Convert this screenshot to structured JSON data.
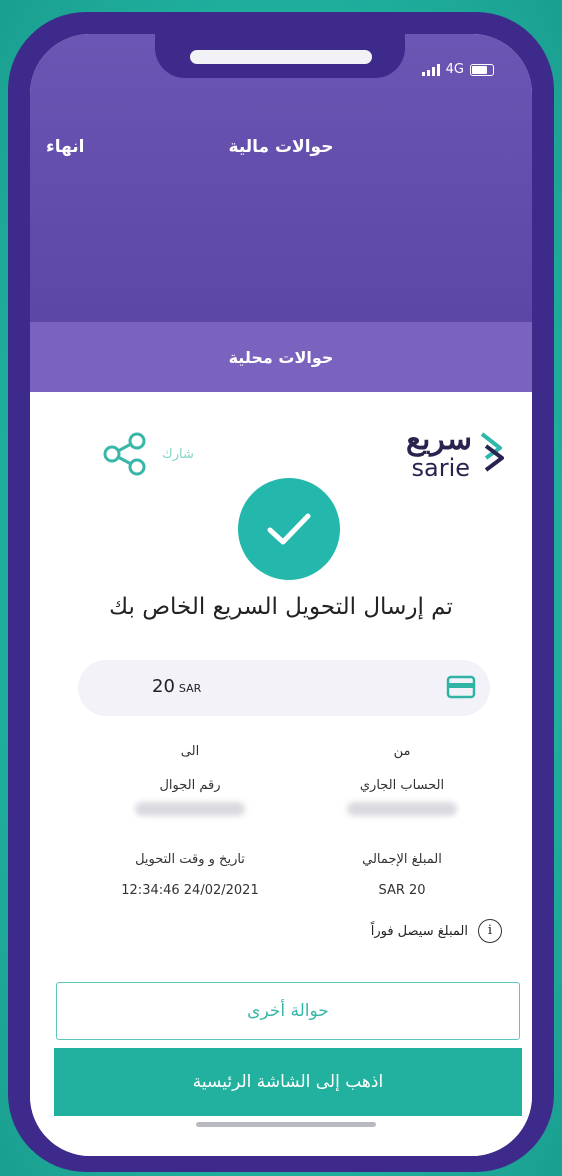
{
  "status_bar": {
    "network": "4G"
  },
  "header": {
    "end_label": "انهاء",
    "title": "حوالات مالية"
  },
  "sub_tab": {
    "label": "حوالات محلية"
  },
  "logo": {
    "arabic": "سريع",
    "english": "sarie"
  },
  "share": {
    "label": "شارك"
  },
  "confirmation": {
    "message": "تم إرسال التحويل السريع الخاص بك"
  },
  "amount": {
    "value": "20",
    "currency": "SAR"
  },
  "details": {
    "from_label": "من",
    "from_account_type": "الحساب الجاري",
    "to_label": "الى",
    "to_type": "رقم الجوال",
    "total_label": "المبلغ الإجمالي",
    "total_value": "SAR 20",
    "datetime_label": "تاريخ و وقت التحويل",
    "datetime_value": "12:34:46 24/02/2021"
  },
  "info": {
    "note": "المبلغ سيصل فوراً"
  },
  "buttons": {
    "another_transfer": "حوالة أخرى",
    "go_home": "اذهب إلى الشاشة الرئيسية"
  },
  "colors": {
    "accent": "#22b19f",
    "header_purple": "#5c46a6",
    "frame": "#3d2a8a"
  },
  "icons": [
    "share-icon",
    "check-icon",
    "card-icon",
    "info-icon"
  ]
}
